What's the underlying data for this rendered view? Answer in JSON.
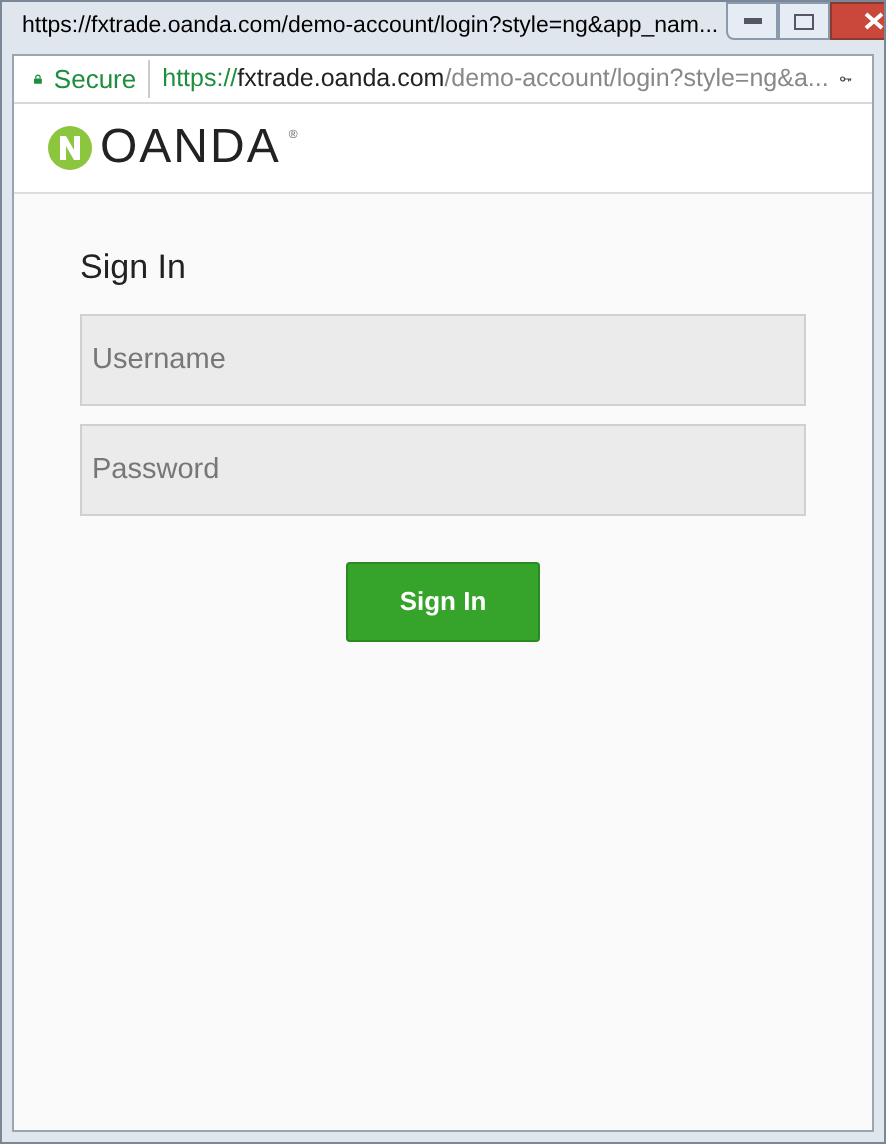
{
  "window": {
    "title": "https://fxtrade.oanda.com/demo-account/login?style=ng&app_nam..."
  },
  "address_bar": {
    "secure_label": "Secure",
    "url_scheme": "https://",
    "url_host": "fxtrade.oanda.com",
    "url_path": "/demo-account/login?style=ng&a..."
  },
  "header": {
    "logo_text": "OANDA",
    "trademark": "®"
  },
  "form": {
    "title": "Sign In",
    "username_field": {
      "placeholder": "Username"
    },
    "password_field": {
      "placeholder": "Password"
    },
    "submit": "Sign In"
  }
}
